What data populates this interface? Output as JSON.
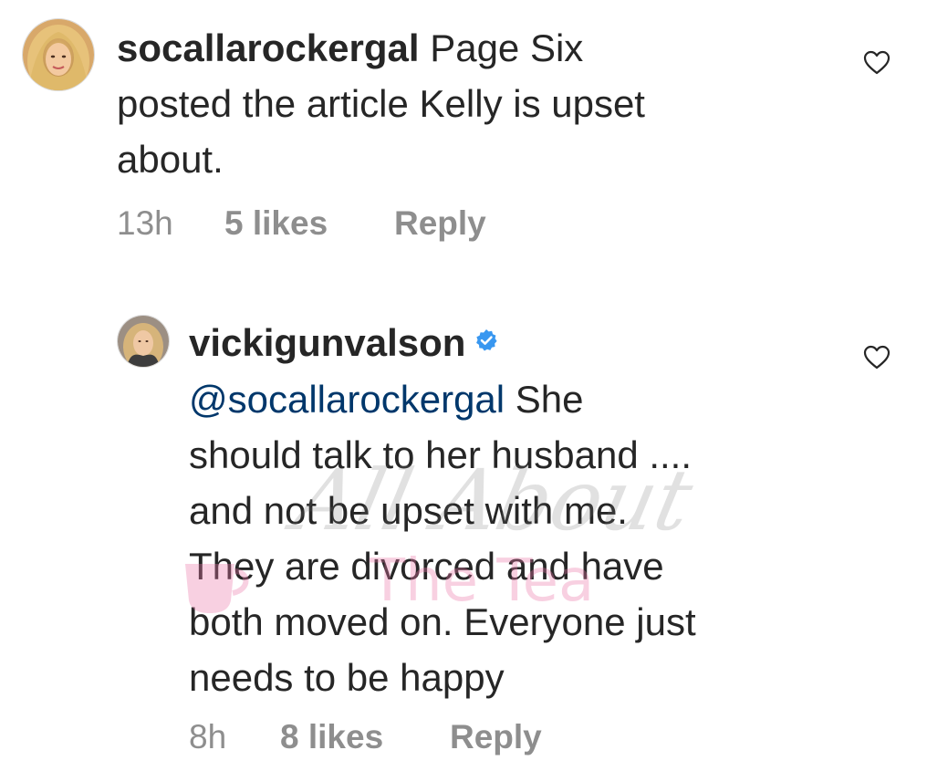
{
  "comments": [
    {
      "username": "socallarockergal",
      "text_line1": " Page Six",
      "text_line2": "posted the article Kelly is upset",
      "text_line3": "about.",
      "time": "13h",
      "likes": "5 likes",
      "reply": "Reply",
      "avatar_icon": "avatar-photo",
      "like_icon": "heart-outline-icon"
    },
    {
      "username": "vickigunvalson",
      "verified_icon": "verified-badge-icon",
      "mention": "@socallarockergal",
      "text_line1": "  She",
      "text_line2": "should talk to her husband ....",
      "text_line3": "and not be upset with me.",
      "text_line4": "They are divorced and have",
      "text_line5": "both moved on.  Everyone just",
      "text_line6": "needs to be happy",
      "time": "8h",
      "likes": "8 likes",
      "reply": "Reply",
      "avatar_icon": "avatar-photo",
      "like_icon": "heart-outline-icon"
    }
  ],
  "watermark": {
    "script": "All About",
    "tea": "The Tea"
  },
  "colors": {
    "text": "#262626",
    "meta": "#8e8e8e",
    "mention": "#00376b",
    "verified": "#3897f0"
  }
}
